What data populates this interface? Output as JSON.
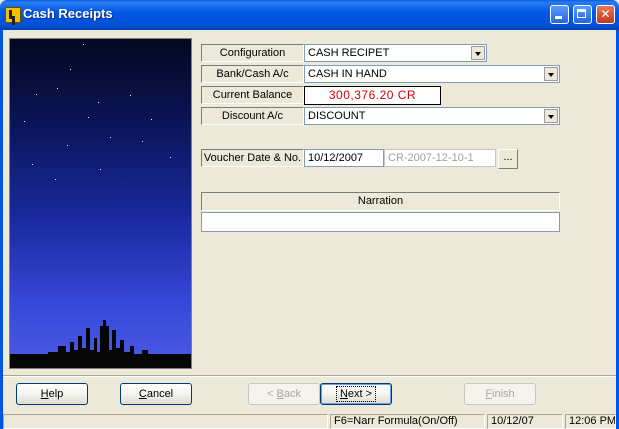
{
  "window": {
    "title": "Cash Receipts"
  },
  "form": {
    "configuration": {
      "label": "Configuration",
      "value": "CASH RECIPET"
    },
    "bank_cash": {
      "label": "Bank/Cash A/c",
      "value": "CASH IN HAND"
    },
    "current_balance": {
      "label": "Current Balance",
      "value": "300,376.20 CR",
      "color": "#d40000"
    },
    "discount": {
      "label": "Discount A/c",
      "value": "DISCOUNT"
    },
    "voucher": {
      "label": "Voucher Date & No.",
      "date": "10/12/2007",
      "number": "CR-2007-12-10-1",
      "browse_label": "..."
    },
    "narration": {
      "header": "Narration",
      "value": ""
    }
  },
  "buttons": {
    "help": {
      "pre": "",
      "accel": "H",
      "post": "elp"
    },
    "cancel": {
      "pre": "",
      "accel": "C",
      "post": "ancel"
    },
    "back": {
      "pre": "< ",
      "accel": "B",
      "post": "ack"
    },
    "next": {
      "pre": "",
      "accel": "N",
      "post": "ext >"
    },
    "finish": {
      "pre": "",
      "accel": "F",
      "post": "inish"
    }
  },
  "statusbar": {
    "hint": "F6=Narr Formula(On/Off)",
    "date": "10/12/07",
    "time": "12:06 PM"
  },
  "colors": {
    "titlebar": "#0054e3",
    "balance_text": "#d40000"
  }
}
